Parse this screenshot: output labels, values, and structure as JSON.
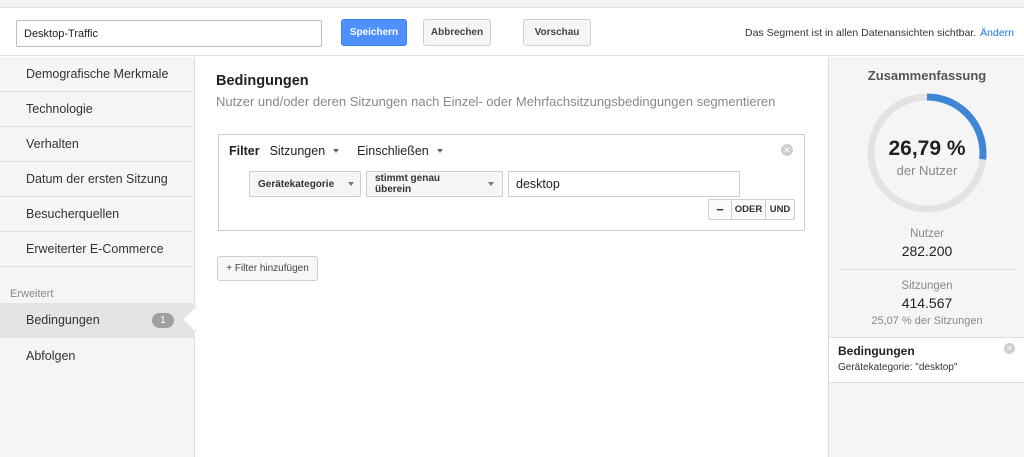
{
  "toolbar": {
    "segment_name": "Desktop-Traffic",
    "save_label": "Speichern",
    "cancel_label": "Abbrechen",
    "preview_label": "Vorschau",
    "visibility_text": "Das Segment ist in allen Datenansichten sichtbar.",
    "change_link": "Ändern"
  },
  "sidebar": {
    "items": [
      {
        "label": "Demografische Merkmale"
      },
      {
        "label": "Technologie"
      },
      {
        "label": "Verhalten"
      },
      {
        "label": "Datum der ersten Sitzung"
      },
      {
        "label": "Besucherquellen"
      },
      {
        "label": "Erweiterter E-Commerce"
      }
    ],
    "section_label": "Erweitert",
    "advanced_items": [
      {
        "label": "Bedingungen",
        "badge": "1"
      },
      {
        "label": "Abfolgen"
      }
    ]
  },
  "main": {
    "title": "Bedingungen",
    "subtitle": "Nutzer und/oder deren Sitzungen nach Einzel- oder Mehrfachsitzungsbedingungen segmentieren",
    "filter": {
      "label": "Filter",
      "scope": "Sitzungen",
      "mode": "Einschließen",
      "dimension": "Gerätekategorie",
      "operator": "stimmt genau überein",
      "value": "desktop",
      "minus_label": "−",
      "or_label": "ODER",
      "and_label": "UND"
    },
    "add_filter_label": "+ Filter hinzufügen"
  },
  "summary": {
    "title": "Zusammenfassung",
    "percent_text": "26,79 %",
    "percent_value": 26.79,
    "percent_caption": "der Nutzer",
    "users_label": "Nutzer",
    "users_value": "282.200",
    "sessions_label": "Sitzungen",
    "sessions_value": "414.567",
    "sessions_note": "25,07 % der Sitzungen",
    "condition_title": "Bedingungen",
    "condition_detail": "Gerätekategorie: \"desktop\""
  },
  "colors": {
    "accent": "#4d90fe",
    "donut_fill": "#3f87d6",
    "donut_track": "#e3e3e3"
  }
}
